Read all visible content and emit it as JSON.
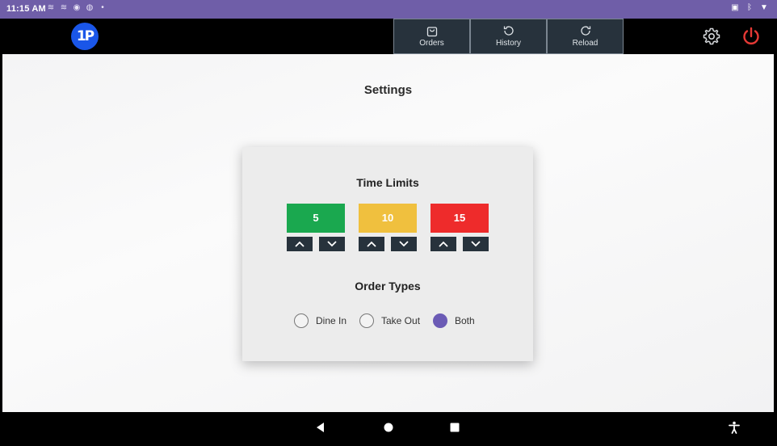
{
  "status_bar": {
    "time": "11:15 AM",
    "left_icons": [
      "data-saver-icon",
      "sync-icon",
      "location-icon",
      "vpn-icon",
      "dot-icon"
    ],
    "right_icons": [
      "cast-icon",
      "bluetooth-icon",
      "wifi-icon"
    ]
  },
  "header": {
    "logo_text": "1P",
    "tabs": [
      {
        "label": "Orders",
        "icon": "bag-icon"
      },
      {
        "label": "History",
        "icon": "history-icon"
      },
      {
        "label": "Reload",
        "icon": "reload-icon"
      }
    ],
    "settings_icon": "gear-icon",
    "power_icon": "power-icon",
    "colors": {
      "power": "#e53935",
      "tab_bg": "#27323c"
    }
  },
  "page": {
    "title": "Settings"
  },
  "time_limits": {
    "title": "Time Limits",
    "items": [
      {
        "value": "5",
        "color": "#1aa84f"
      },
      {
        "value": "10",
        "color": "#f0c03e"
      },
      {
        "value": "15",
        "color": "#ee2b2b"
      }
    ]
  },
  "order_types": {
    "title": "Order Types",
    "options": [
      {
        "label": "Dine In",
        "checked": false
      },
      {
        "label": "Take Out",
        "checked": false
      },
      {
        "label": "Both",
        "checked": true
      }
    ],
    "selected_color": "#6b5bb5"
  },
  "nav_bar": {
    "icons": [
      "back-icon",
      "home-icon",
      "recents-icon",
      "accessibility-icon"
    ]
  }
}
